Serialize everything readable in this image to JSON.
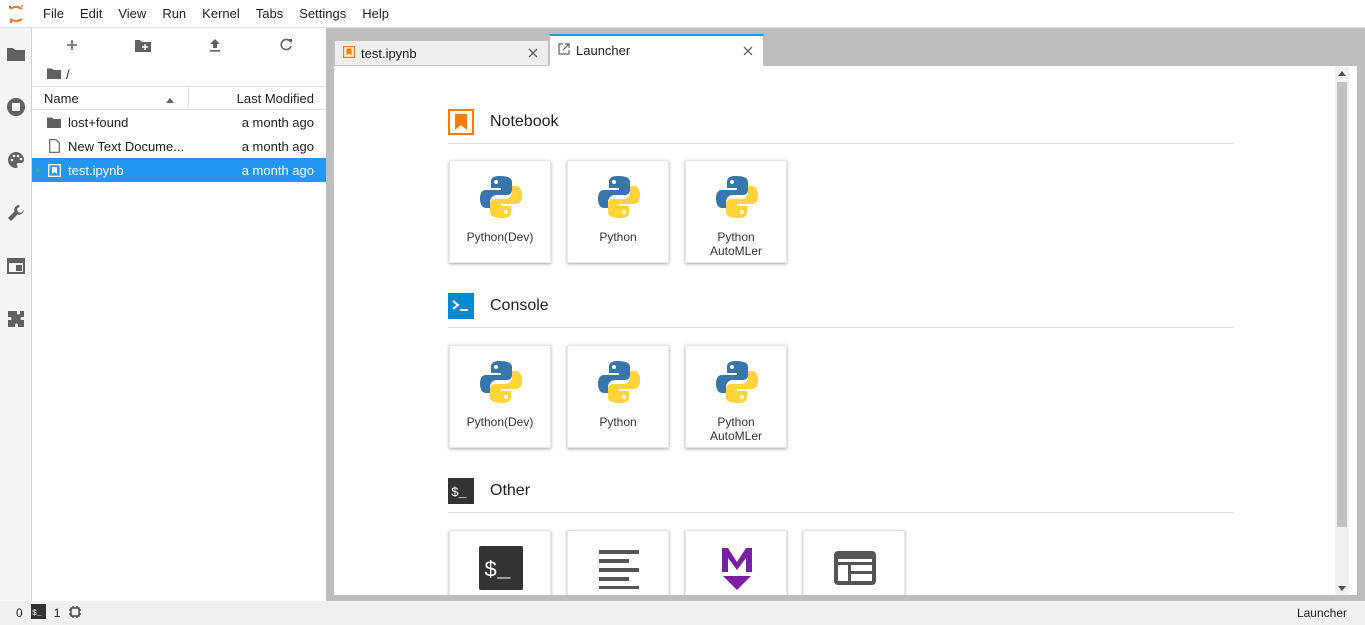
{
  "menubar": {
    "items": [
      "File",
      "Edit",
      "View",
      "Run",
      "Kernel",
      "Tabs",
      "Settings",
      "Help"
    ]
  },
  "filebrowser": {
    "breadcrumb": "/",
    "columns": {
      "name": "Name",
      "modified": "Last Modified"
    },
    "rows": [
      {
        "name": "lost+found",
        "modified": "a month ago",
        "type": "folder"
      },
      {
        "name": "New Text Docume...",
        "modified": "a month ago",
        "type": "file"
      },
      {
        "name": "test.ipynb",
        "modified": "a month ago",
        "type": "notebook",
        "selected": true
      }
    ]
  },
  "tabs": [
    {
      "label": "test.ipynb",
      "active": false
    },
    {
      "label": "Launcher",
      "active": true
    }
  ],
  "launcher": {
    "sections": [
      {
        "title": "Notebook",
        "cards": [
          "Python(Dev)",
          "Python",
          "Python AutoMLer"
        ]
      },
      {
        "title": "Console",
        "cards": [
          "Python(Dev)",
          "Python",
          "Python AutoMLer"
        ]
      },
      {
        "title": "Other",
        "cards": [
          "",
          "",
          "",
          ""
        ]
      }
    ]
  },
  "statusbar": {
    "left_count_a": "0",
    "left_count_b": "1",
    "right_label": "Launcher"
  },
  "colors": {
    "accent": "#2196f3",
    "notebook_orange": "#f57c00",
    "console_blue": "#0288d1",
    "markdown_purple": "#7b1fa2"
  }
}
